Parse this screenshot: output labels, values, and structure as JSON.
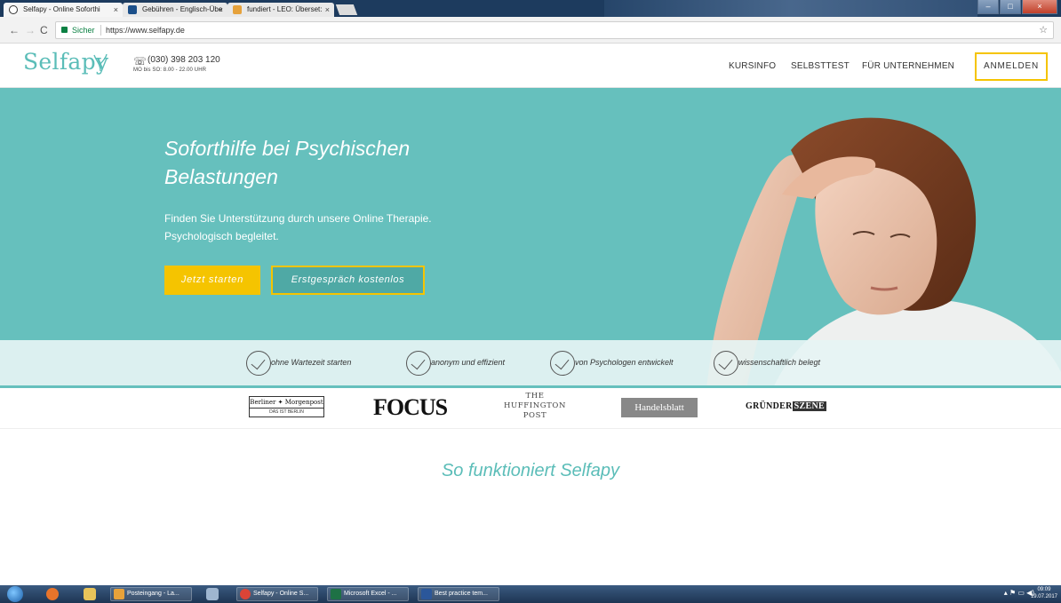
{
  "browser": {
    "tabs": [
      {
        "label": "Selfapy - Online Soforthi",
        "active": true
      },
      {
        "label": "Gebühren - Englisch-Übe",
        "active": false
      },
      {
        "label": "fundiert - LEO: Überset:",
        "active": false
      }
    ],
    "secure_label": "Sicher",
    "url": "https://www.selfapy.de"
  },
  "header": {
    "logo": "Selfapy",
    "phone": "(030) 398 203 120",
    "hours": "MO bis SO: 8.00 - 22.00 UHR",
    "nav": [
      "KURSINFO",
      "SELBSTTEST",
      "FÜR UNTERNEHMEN"
    ],
    "login": "ANMELDEN"
  },
  "hero": {
    "title": "Soforthilfe bei Psychischen Belastungen",
    "text_line1": "Finden Sie Unterstützung durch unsere Online Therapie.",
    "text_line2": "Psychologisch begleitet.",
    "btn_start": "Jetzt starten",
    "btn_talk": "Erstgespräch kostenlos"
  },
  "features": [
    "ohne Wartezeit starten",
    "anonym und effizient",
    "von Psychologen entwickelt",
    "wissenschaftlich belegt"
  ],
  "press": {
    "berliner_line1": "Berliner ✦ Morgenpost",
    "berliner_line2": "DAS IST BERLIN",
    "focus": "FOCUS",
    "huff_line1": "THE",
    "huff_line2": "HUFFINGTON",
    "huff_line3": "POST",
    "handelsblatt": "Handelsblatt",
    "gs_a": "GRÜNDER",
    "gs_b": "SZENE"
  },
  "section_title": "So funktioniert Selfapy",
  "taskbar": {
    "tasks": [
      "Posteingang - La...",
      "Selfapy - Online S...",
      "Microsoft Excel - ...",
      "Best practice tem..."
    ],
    "time": "09:09",
    "date": "19.07.2017"
  },
  "colors": {
    "teal": "#66c0bd",
    "accent": "#f5c400",
    "brand": "#5bbdb8"
  }
}
